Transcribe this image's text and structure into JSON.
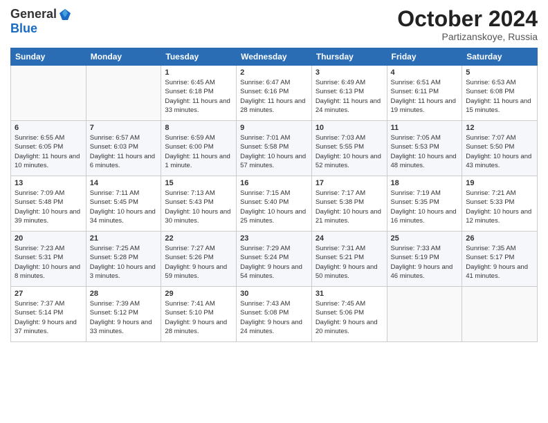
{
  "logo": {
    "general": "General",
    "blue": "Blue"
  },
  "title": "October 2024",
  "location": "Partizanskoye, Russia",
  "days_of_week": [
    "Sunday",
    "Monday",
    "Tuesday",
    "Wednesday",
    "Thursday",
    "Friday",
    "Saturday"
  ],
  "weeks": [
    [
      {
        "day": "",
        "info": ""
      },
      {
        "day": "",
        "info": ""
      },
      {
        "day": "1",
        "info": "Sunrise: 6:45 AM\nSunset: 6:18 PM\nDaylight: 11 hours\nand 33 minutes."
      },
      {
        "day": "2",
        "info": "Sunrise: 6:47 AM\nSunset: 6:16 PM\nDaylight: 11 hours\nand 28 minutes."
      },
      {
        "day": "3",
        "info": "Sunrise: 6:49 AM\nSunset: 6:13 PM\nDaylight: 11 hours\nand 24 minutes."
      },
      {
        "day": "4",
        "info": "Sunrise: 6:51 AM\nSunset: 6:11 PM\nDaylight: 11 hours\nand 19 minutes."
      },
      {
        "day": "5",
        "info": "Sunrise: 6:53 AM\nSunset: 6:08 PM\nDaylight: 11 hours\nand 15 minutes."
      }
    ],
    [
      {
        "day": "6",
        "info": "Sunrise: 6:55 AM\nSunset: 6:05 PM\nDaylight: 11 hours\nand 10 minutes."
      },
      {
        "day": "7",
        "info": "Sunrise: 6:57 AM\nSunset: 6:03 PM\nDaylight: 11 hours\nand 6 minutes."
      },
      {
        "day": "8",
        "info": "Sunrise: 6:59 AM\nSunset: 6:00 PM\nDaylight: 11 hours\nand 1 minute."
      },
      {
        "day": "9",
        "info": "Sunrise: 7:01 AM\nSunset: 5:58 PM\nDaylight: 10 hours\nand 57 minutes."
      },
      {
        "day": "10",
        "info": "Sunrise: 7:03 AM\nSunset: 5:55 PM\nDaylight: 10 hours\nand 52 minutes."
      },
      {
        "day": "11",
        "info": "Sunrise: 7:05 AM\nSunset: 5:53 PM\nDaylight: 10 hours\nand 48 minutes."
      },
      {
        "day": "12",
        "info": "Sunrise: 7:07 AM\nSunset: 5:50 PM\nDaylight: 10 hours\nand 43 minutes."
      }
    ],
    [
      {
        "day": "13",
        "info": "Sunrise: 7:09 AM\nSunset: 5:48 PM\nDaylight: 10 hours\nand 39 minutes."
      },
      {
        "day": "14",
        "info": "Sunrise: 7:11 AM\nSunset: 5:45 PM\nDaylight: 10 hours\nand 34 minutes."
      },
      {
        "day": "15",
        "info": "Sunrise: 7:13 AM\nSunset: 5:43 PM\nDaylight: 10 hours\nand 30 minutes."
      },
      {
        "day": "16",
        "info": "Sunrise: 7:15 AM\nSunset: 5:40 PM\nDaylight: 10 hours\nand 25 minutes."
      },
      {
        "day": "17",
        "info": "Sunrise: 7:17 AM\nSunset: 5:38 PM\nDaylight: 10 hours\nand 21 minutes."
      },
      {
        "day": "18",
        "info": "Sunrise: 7:19 AM\nSunset: 5:35 PM\nDaylight: 10 hours\nand 16 minutes."
      },
      {
        "day": "19",
        "info": "Sunrise: 7:21 AM\nSunset: 5:33 PM\nDaylight: 10 hours\nand 12 minutes."
      }
    ],
    [
      {
        "day": "20",
        "info": "Sunrise: 7:23 AM\nSunset: 5:31 PM\nDaylight: 10 hours\nand 8 minutes."
      },
      {
        "day": "21",
        "info": "Sunrise: 7:25 AM\nSunset: 5:28 PM\nDaylight: 10 hours\nand 3 minutes."
      },
      {
        "day": "22",
        "info": "Sunrise: 7:27 AM\nSunset: 5:26 PM\nDaylight: 9 hours\nand 59 minutes."
      },
      {
        "day": "23",
        "info": "Sunrise: 7:29 AM\nSunset: 5:24 PM\nDaylight: 9 hours\nand 54 minutes."
      },
      {
        "day": "24",
        "info": "Sunrise: 7:31 AM\nSunset: 5:21 PM\nDaylight: 9 hours\nand 50 minutes."
      },
      {
        "day": "25",
        "info": "Sunrise: 7:33 AM\nSunset: 5:19 PM\nDaylight: 9 hours\nand 46 minutes."
      },
      {
        "day": "26",
        "info": "Sunrise: 7:35 AM\nSunset: 5:17 PM\nDaylight: 9 hours\nand 41 minutes."
      }
    ],
    [
      {
        "day": "27",
        "info": "Sunrise: 7:37 AM\nSunset: 5:14 PM\nDaylight: 9 hours\nand 37 minutes."
      },
      {
        "day": "28",
        "info": "Sunrise: 7:39 AM\nSunset: 5:12 PM\nDaylight: 9 hours\nand 33 minutes."
      },
      {
        "day": "29",
        "info": "Sunrise: 7:41 AM\nSunset: 5:10 PM\nDaylight: 9 hours\nand 28 minutes."
      },
      {
        "day": "30",
        "info": "Sunrise: 7:43 AM\nSunset: 5:08 PM\nDaylight: 9 hours\nand 24 minutes."
      },
      {
        "day": "31",
        "info": "Sunrise: 7:45 AM\nSunset: 5:06 PM\nDaylight: 9 hours\nand 20 minutes."
      },
      {
        "day": "",
        "info": ""
      },
      {
        "day": "",
        "info": ""
      }
    ]
  ]
}
